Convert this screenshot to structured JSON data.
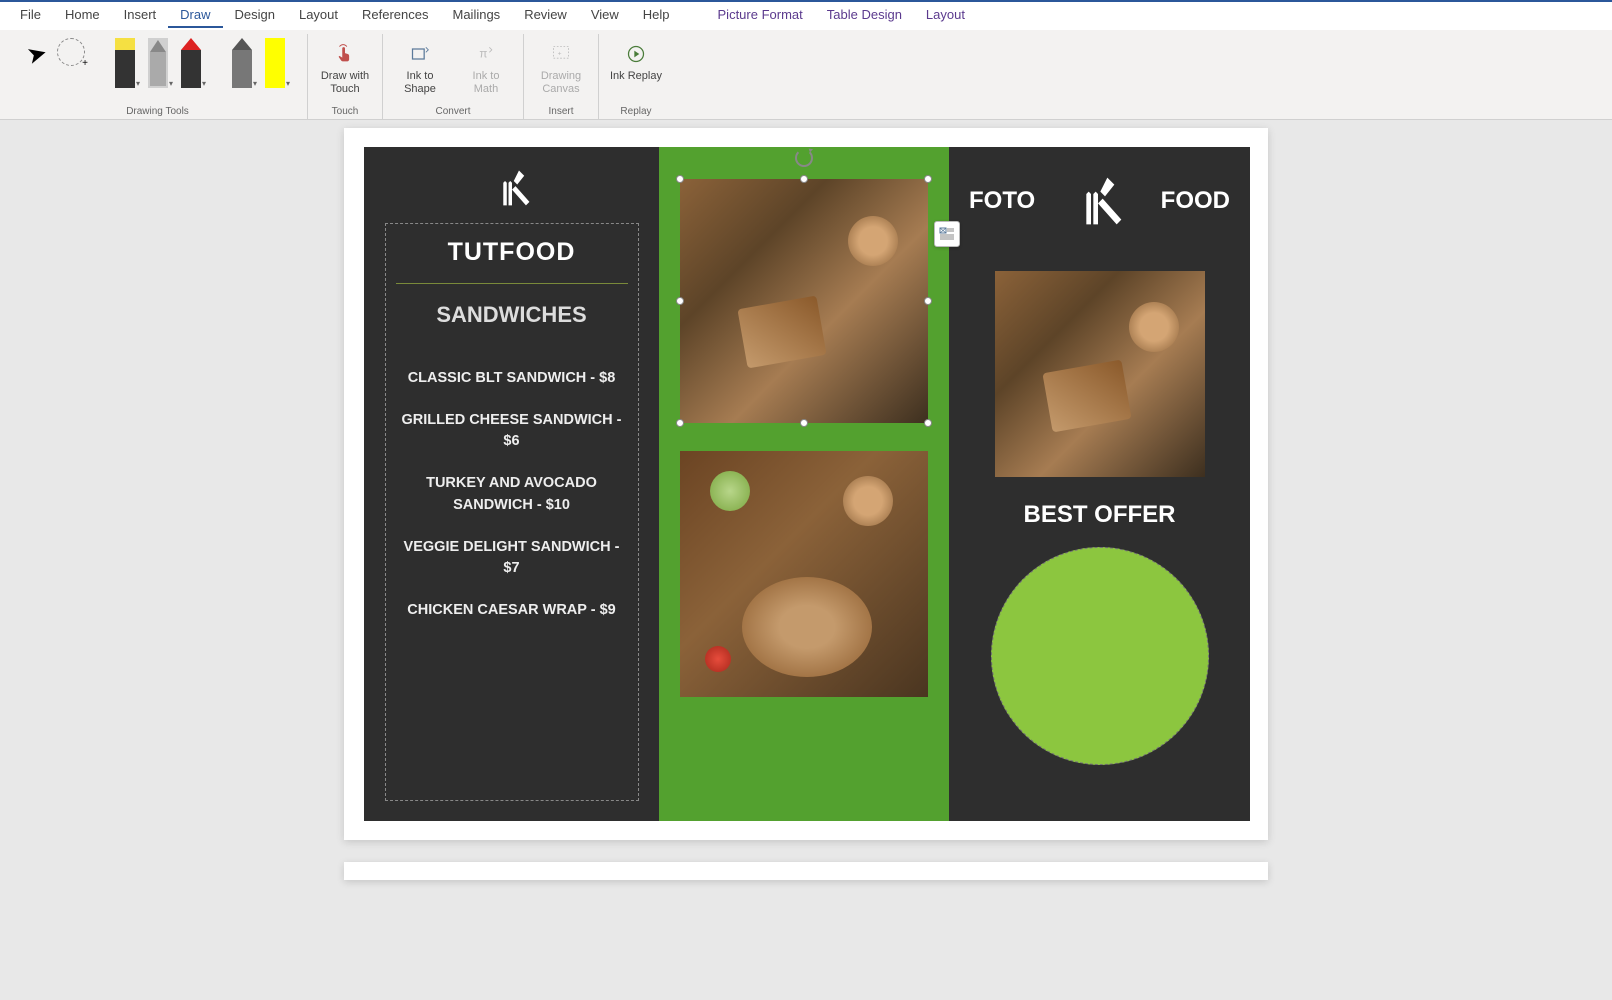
{
  "ribbon": {
    "tabs": [
      "File",
      "Home",
      "Insert",
      "Draw",
      "Design",
      "Layout",
      "References",
      "Mailings",
      "Review",
      "View",
      "Help"
    ],
    "contextual_tabs": [
      "Picture Format",
      "Table Design",
      "Layout"
    ],
    "active_tab": "Draw",
    "groups": {
      "drawing_tools": "Drawing Tools",
      "touch": "Touch",
      "convert": "Convert",
      "insert": "Insert",
      "replay": "Replay"
    },
    "buttons": {
      "draw_touch": "Draw with Touch",
      "ink_shape": "Ink to Shape",
      "ink_math": "Ink to Math",
      "drawing_canvas": "Drawing Canvas",
      "ink_replay": "Ink Replay"
    }
  },
  "brochure": {
    "left": {
      "title": "TUTFOOD",
      "subtitle": "SANDWICHES",
      "items": [
        "CLASSIC BLT SANDWICH - $8",
        "GRILLED CHEESE SANDWICH - $6",
        "TURKEY AND AVOCADO SANDWICH - $10",
        "VEGGIE DELIGHT SANDWICH - $7",
        "CHICKEN CAESAR WRAP - $9"
      ]
    },
    "right": {
      "word1": "FOTO",
      "word2": "FOOD",
      "best_offer": "BEST OFFER"
    }
  }
}
